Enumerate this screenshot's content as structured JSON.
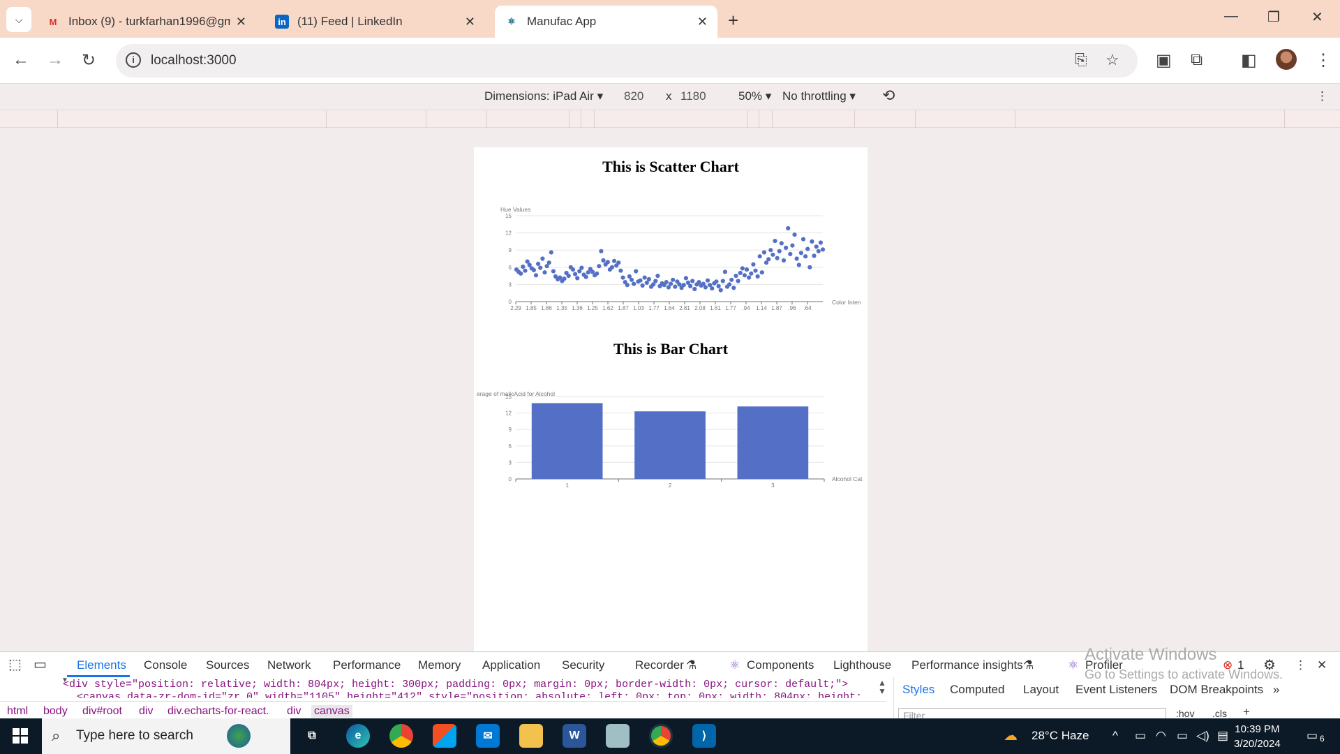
{
  "browser": {
    "tabs": [
      {
        "title": "Inbox (9) - turkfarhan1996@gm",
        "icon": "gmail-icon"
      },
      {
        "title": "(11) Feed | LinkedIn",
        "icon": "linkedin-icon"
      },
      {
        "title": "Manufac App",
        "icon": "react-icon"
      }
    ],
    "url": "localhost:3000"
  },
  "device_toolbar": {
    "dimensions": "Dimensions: iPad Air",
    "width": "820",
    "times": "x",
    "height": "1180",
    "zoom": "50%",
    "throttling": "No throttling"
  },
  "scatter": {
    "title": "This is Scatter Chart",
    "ylabel": "Hue Values",
    "xlabel": "Color Inten",
    "yticks": [
      "15",
      "12",
      "9",
      "6",
      "3",
      "0"
    ],
    "xticks": [
      "2.29",
      "1.85",
      "1.86",
      "1.35",
      "1.36",
      "1.25",
      "1.62",
      "1.87",
      "1.03",
      "1.77",
      "1.64",
      "2.81",
      "2.08",
      "1.61",
      "1.77",
      ".94",
      "1.14",
      "1.87",
      ".96",
      ".64"
    ]
  },
  "bar": {
    "title": "This is Bar Chart",
    "ylabel": "erage of malicAcid for Alcohol",
    "xlabel": "Alcohol Cat",
    "yticks": [
      "15",
      "12",
      "9",
      "6",
      "3",
      "0"
    ]
  },
  "chart_data": [
    {
      "type": "scatter",
      "title": "This is Scatter Chart",
      "xlabel": "Color Inten",
      "ylabel": "Hue Values",
      "ylim": [
        0,
        15
      ],
      "color": "#5470c6",
      "x_categories": [
        "2.29",
        "1.85",
        "1.86",
        "1.35",
        "1.36",
        "1.25",
        "1.62",
        "1.87",
        "1.03",
        "1.77",
        "1.64",
        "2.81",
        "2.08",
        "1.61",
        "1.77",
        ".94",
        "1.14",
        "1.87",
        ".96",
        ".64"
      ],
      "values": [
        5.6,
        5.2,
        4.9,
        6.1,
        5.4,
        7.0,
        6.4,
        5.8,
        5.5,
        4.6,
        6.6,
        5.9,
        7.5,
        5.1,
        6.2,
        6.8,
        8.6,
        5.3,
        4.4,
        3.9,
        4.2,
        3.6,
        4.0,
        5.0,
        4.5,
        6.0,
        5.6,
        4.8,
        4.1,
        5.3,
        5.9,
        4.7,
        4.3,
        5.1,
        5.7,
        5.2,
        4.6,
        4.9,
        6.2,
        8.8,
        7.2,
        6.5,
        6.9,
        5.6,
        6.0,
        7.1,
        6.3,
        6.8,
        5.4,
        4.2,
        3.4,
        2.9,
        4.4,
        3.8,
        3.1,
        5.3,
        3.5,
        3.7,
        2.8,
        4.2,
        3.3,
        3.9,
        2.6,
        3.0,
        3.6,
        4.5,
        2.7,
        3.2,
        2.9,
        3.4,
        2.5,
        3.1,
        3.8,
        2.6,
        3.5,
        3.0,
        2.4,
        2.9,
        4.1,
        3.3,
        2.7,
        3.6,
        2.2,
        3.0,
        3.4,
        2.8,
        3.1,
        2.5,
        3.7,
        2.9,
        2.3,
        3.2,
        3.5,
        2.7,
        2.0,
        3.6,
        5.2,
        2.6,
        3.0,
        3.8,
        2.4,
        4.5,
        3.6,
        5.0,
        5.8,
        4.6,
        5.6,
        4.2,
        4.9,
        6.5,
        5.4,
        4.4,
        7.9,
        5.1,
        8.6,
        6.8,
        7.4,
        9.0,
        8.2,
        10.6,
        7.6,
        8.8,
        10.2,
        7.2,
        9.4,
        12.8,
        8.3,
        9.8,
        11.7,
        7.5,
        6.4,
        8.5,
        10.9,
        7.9,
        9.2,
        6.0,
        10.5,
        8.0,
        9.6,
        8.8,
        10.3,
        9.1
      ]
    },
    {
      "type": "bar",
      "title": "This is Bar Chart",
      "xlabel": "Alcohol Cat",
      "ylabel": "erage of malicAcid for Alcohol",
      "ylim": [
        0,
        15
      ],
      "color": "#5470c6",
      "categories": [
        "1",
        "2",
        "3"
      ],
      "values": [
        13.8,
        12.3,
        13.2
      ]
    }
  ],
  "devtools": {
    "tabs": [
      "Elements",
      "Console",
      "Sources",
      "Network",
      "Performance",
      "Memory",
      "Application",
      "Security",
      "Recorder",
      "Components",
      "Lighthouse",
      "Performance insights",
      "Profiler"
    ],
    "error_count": "1",
    "dom_line": "<div style=\"position: relative; width: 804px; height: 300px; padding: 0px; margin: 0px; border-width: 0px; cursor: default;\">",
    "dom_line2": "<canvas data-zr-dom-id=\"zr_0\" width=\"1105\" height=\"412\" style=\"position: absolute; left: 0px; top: 0px; width: 804px; height:",
    "breadcrumbs": [
      "html",
      "body",
      "div#root",
      "div",
      "div.echarts-for-react.",
      "div",
      "canvas"
    ],
    "styles_tabs": [
      "Styles",
      "Computed",
      "Layout",
      "Event Listeners",
      "DOM Breakpoints"
    ],
    "filter_placeholder": "Filter",
    "hov": ":hov",
    "cls": ".cls"
  },
  "watermark": {
    "line1": "Activate Windows",
    "line2": "Go to Settings to activate Windows."
  },
  "taskbar": {
    "search_placeholder": "Type here to search",
    "weather": "28°C  Haze",
    "time": "10:39 PM",
    "date": "3/20/2024",
    "notifications": "6"
  }
}
